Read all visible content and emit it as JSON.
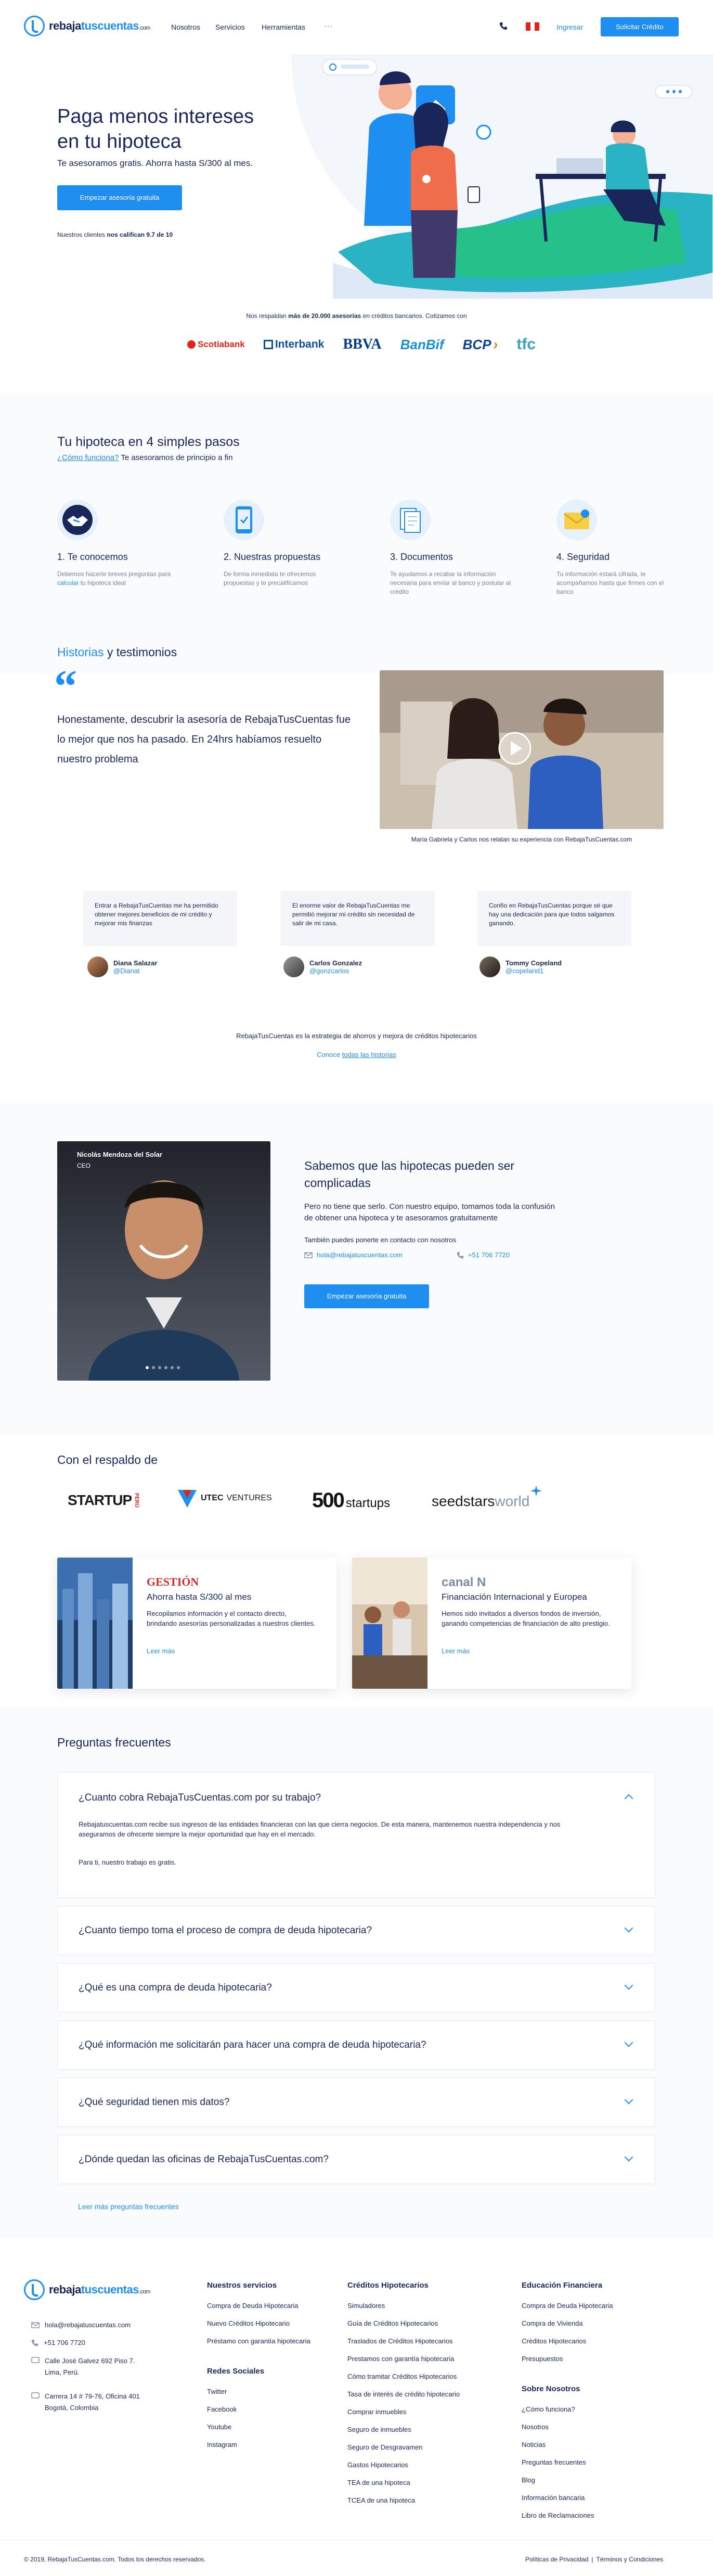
{
  "nav": {
    "logo": {
      "part1": "rebaja",
      "part2": "tuscuentas",
      "suffix": ".com"
    },
    "links": [
      "Nosotros",
      "Servicios",
      "Herramientas"
    ],
    "more": "···",
    "login": "Ingresar",
    "cta": "Solicitar Crédito"
  },
  "hero": {
    "title": "Paga menos intereses en tu hipoteca",
    "subtitle": "Te asesoramos gratis. Ahorra hasta S/300 al mes.",
    "cta": "Empezar asesoría gratuita",
    "rating_prefix": "Nuestros clientes",
    "rating_bold": "nos califican 9.7 de 10"
  },
  "banks": {
    "prefix": "Nos respaldan",
    "bold": "más de 20.000 asesorías",
    "suffix": "en créditos bancarios. Cotizamos con",
    "logos": [
      "Scotiabank",
      "Interbank",
      "BBVA",
      "BanBif",
      "BCP",
      "tfc"
    ]
  },
  "steps": {
    "title": "Tu hipoteca en 4 simples pasos",
    "link": "¿Cómo funciona?",
    "link_suffix": "Te asesoramos de principio a fin",
    "items": [
      {
        "title": "1. Te conocemos",
        "desc_a": "Debemos hacerte breves preguntas para",
        "desc_link": "calcular",
        "desc_b": "tu hipoteca ideal"
      },
      {
        "title": "2. Nuestras propuestas",
        "desc": "De forma inmediata te ofrecemos propuestas y te precalificamos"
      },
      {
        "title": "3. Documentos",
        "desc": "Te ayudamos a recabar la información necesaria para enviar al banco y postular al crédito"
      },
      {
        "title": "4. Seguridad",
        "desc": "Tu información estará cifrada, te acompañamos hasta que firmes con el banco"
      }
    ]
  },
  "testimonials": {
    "title_blue": "Historias",
    "title_rest": "y testimonios",
    "quote_mark": "“",
    "quote": "Honestamente, descubrir la asesoría de RebajaTusCuentas fue lo mejor que nos ha pasado. En 24hrs habíamos resuelto nuestro problema",
    "video_caption": "María Gabriela y Carlos nos relatan su experiencia con RebajaTusCuentas.com",
    "cards": [
      {
        "text": "Entrar a RebajaTusCuentas me ha permitido obtener mejores beneficios de mi crédito y mejorar mis finanzas",
        "name": "Diana Salazar",
        "handle": "@Dianat"
      },
      {
        "text": "El enorme valor de RebajaTusCuentas me permitió mejorar mi crédito sin necesidad de salir de mi casa.",
        "name": "Carlos Gonzalez",
        "handle": "@gonzcarlos"
      },
      {
        "text": "Confío en RebajaTusCuentas porque sé que hay una dedicación para que todos salgamos ganando.",
        "name": "Tommy Copeland",
        "handle": "@copeland1"
      }
    ],
    "strategy": "RebajaTusCuentas es la estrategia de ahorros y mejora de créditos hipotecarios",
    "stories_prefix": "Conoce",
    "stories_link": "todas las historias"
  },
  "team": {
    "person_name": "Nicolás Mendoza del Solar",
    "person_role": "CEO",
    "title": "Sabemos que las hipotecas pueden ser complicadas",
    "body": "Pero no tiene que serlo. Con nuestro equipo, tomamos toda la confusión de obtener una hipoteca y te asesoramos gratuitamente",
    "contact_intro": "También puedes ponerte en contacto con nosotros",
    "email": "hola@rebajatuscuentas.com",
    "phone": "+51 706 7720",
    "cta": "Empezar asesoría gratuita"
  },
  "backers": {
    "title": "Con el respaldo de",
    "logos": [
      "STARTUP",
      "PERÚ",
      "UTEC",
      "VENTURES",
      "500",
      "startups",
      "seedstars",
      "world"
    ]
  },
  "press": [
    {
      "source": "GESTIÓN",
      "title": "Ahorra hasta S/300 al mes",
      "body": "Recopilamos información y el contacto directo, brindando asesorías personalizadas a nuestros clientes.",
      "link": "Leer más"
    },
    {
      "source": "canal N",
      "title": "Financiación Internacional y Europea",
      "body": "Hemos sido invitados a diversos fondos de inversión, ganando competencias de financiación de alto prestigio.",
      "link": "Leer más"
    }
  ],
  "faq": {
    "title": "Preguntas frecuentes",
    "items": [
      {
        "q": "¿Cuanto cobra RebajaTusCuentas.com por su trabajo?",
        "a1": "Rebajatuscuentas.com recibe sus ingresos de las entidades financieras con las que cierra negocios. De esta manera, mantenemos nuestra independencia y nos aseguramos de ofrecerte siempre la mejor oportunidad que hay en el mercado.",
        "a2": "Para ti, nuestro trabajo es gratis."
      },
      {
        "q": "¿Cuanto tiempo toma el proceso de compra de deuda hipotecaria?"
      },
      {
        "q": "¿Qué es una compra de deuda hipotecaria?"
      },
      {
        "q": "¿Qué información me solicitarán para hacer una compra de deuda hipotecaria?"
      },
      {
        "q": "¿Qué seguridad tienen mis datos?"
      },
      {
        "q": "¿Dónde quedan las oficinas de RebajaTusCuentas.com?"
      }
    ],
    "more": "Leer más preguntas frecuentes"
  },
  "footer": {
    "email": "hola@rebajatuscuentas.com",
    "phone": "+51 706 7720",
    "address1a": "Calle José Galvez 692 Piso 7.",
    "address1b": "Lima, Perú.",
    "address2a": "Carrera 14 # 79-76, Oficina 401",
    "address2b": "Bogotá, Colombia",
    "col1_title": "Nuestros servicios",
    "col1": [
      "Compra de Deuda Hipotecaria",
      "Nuevo Créditos Hipotecario",
      "Préstamo con garantía hipotecaria"
    ],
    "social_title": "Redes Sociales",
    "social": [
      "Twitter",
      "Facebook",
      "Youtube",
      "Instagram"
    ],
    "col2_title": "Créditos Hipotecarios",
    "col2": [
      "Simuladores",
      "Guía de Créditos Hipotecarios",
      "Traslados de Créditos Hipotecarios",
      "Prestamos con garantía hipotecaria",
      "Cómo tramitar Créditos Hipotecarios",
      "Tasa de interés de crédito hipotecario",
      "Comprar inmuebles",
      "Seguro de inmuebles",
      "Seguro de Desgravamen",
      "Gastos Hipotecarios",
      "TEA de una hipoteca",
      "TCEA de una hipoteca"
    ],
    "col3_title": "Educación Financiera",
    "col3": [
      "Compra de Deuda Hipotecaria",
      "Compra de Vivienda",
      "Créditos Hipotecarios",
      "Presupuestos"
    ],
    "col4_title": "Sobre Nosotros",
    "col4": [
      "¿Cómo funciona?",
      "Nosotros",
      "Noticias",
      "Preguntas frecuentes",
      "Blog",
      "Información bancaria",
      "Libro de Reclamaciones"
    ],
    "copyright": "© 2019, RebajaTusCuentas.com. Todos los derechos reservados.",
    "privacy": "Políticas de Privacidad",
    "sep": "|",
    "terms": "Términos y Condiciones"
  },
  "colors": {
    "accent": "#1e8ef0",
    "navy": "#1a2659",
    "soft": "#f4f5f9"
  }
}
